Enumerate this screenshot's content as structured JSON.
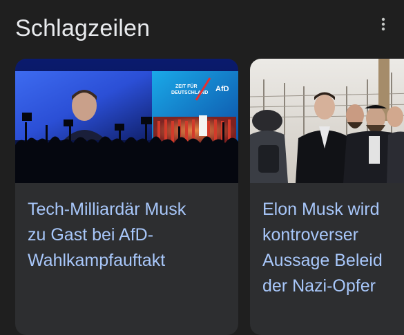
{
  "header": {
    "title": "Schlagzeilen",
    "more_icon": "more-vert-icon"
  },
  "cards": [
    {
      "title": "Tech-Milliardär Musk\nzu Gast bei AfD-\nWahlkampfauftakt",
      "image": {
        "icon": "news-photo-rally",
        "banner_lines": [
          "ZEIT FÜR",
          "DEUTSCHLAND"
        ],
        "banner_logo": "AfD"
      }
    },
    {
      "title": "Elon Musk wird\nkontroverser\nAussage Beleid\nder Nazi-Opfer",
      "image": {
        "icon": "news-photo-group"
      }
    }
  ],
  "colors": {
    "background": "#1f1f1f",
    "card": "#2d2e30",
    "headline_link": "#a8c7fa",
    "title_text": "#e8eaed"
  }
}
